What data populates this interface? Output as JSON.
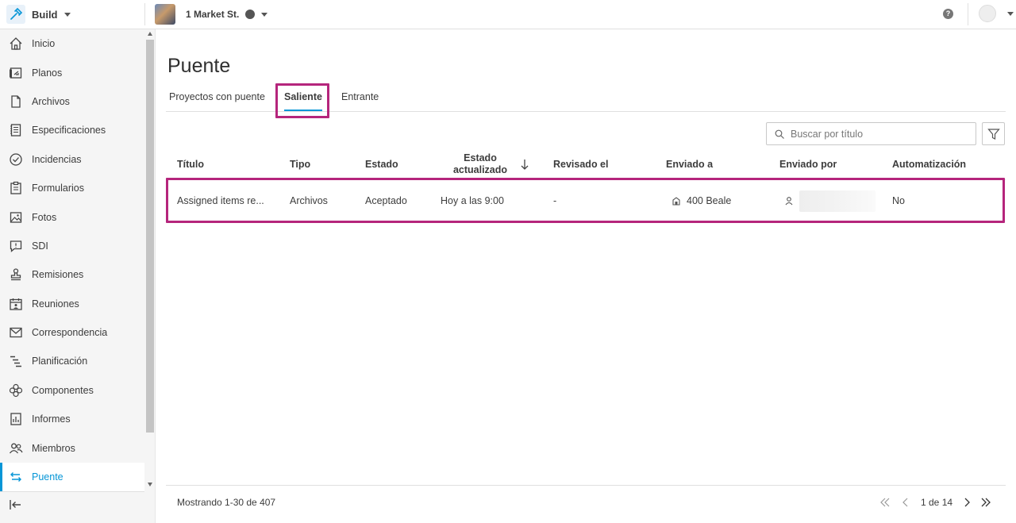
{
  "app": {
    "name": "Build"
  },
  "project": {
    "name": "1 Market St."
  },
  "sidebar": {
    "items": [
      {
        "label": "Inicio",
        "icon": "home-icon"
      },
      {
        "label": "Planos",
        "icon": "sheets-icon"
      },
      {
        "label": "Archivos",
        "icon": "file-icon"
      },
      {
        "label": "Especificaciones",
        "icon": "specifications-icon"
      },
      {
        "label": "Incidencias",
        "icon": "issues-icon"
      },
      {
        "label": "Formularios",
        "icon": "forms-icon"
      },
      {
        "label": "Fotos",
        "icon": "photos-icon"
      },
      {
        "label": "SDI",
        "icon": "rfi-icon"
      },
      {
        "label": "Remisiones",
        "icon": "submittals-icon"
      },
      {
        "label": "Reuniones",
        "icon": "meetings-icon"
      },
      {
        "label": "Correspondencia",
        "icon": "mail-icon"
      },
      {
        "label": "Planificación",
        "icon": "schedule-icon"
      },
      {
        "label": "Componentes",
        "icon": "components-icon"
      },
      {
        "label": "Informes",
        "icon": "reports-icon"
      },
      {
        "label": "Miembros",
        "icon": "members-icon"
      },
      {
        "label": "Puente",
        "icon": "bridge-icon",
        "active": true
      }
    ]
  },
  "main": {
    "title": "Puente",
    "tabs": [
      {
        "label": "Proyectos con puente"
      },
      {
        "label": "Saliente",
        "active": true
      },
      {
        "label": "Entrante"
      }
    ],
    "search": {
      "placeholder": "Buscar por título"
    },
    "table": {
      "headers": [
        "Título",
        "Tipo",
        "Estado",
        "Estado actualizado",
        "Revisado el",
        "Enviado a",
        "Enviado por",
        "Automatización"
      ],
      "rows": [
        {
          "title": "Assigned items re...",
          "type": "Archivos",
          "status": "Aceptado",
          "updated": "Hoy a las 9:00",
          "reviewed": "-",
          "sent_to": "400 Beale",
          "sent_by": "",
          "automation": "No"
        }
      ]
    },
    "footer": {
      "showing": "Mostrando 1-30 de 407",
      "page": "1 de 14"
    }
  },
  "colors": {
    "accent": "#0696d7",
    "highlight": "#b5257c"
  }
}
